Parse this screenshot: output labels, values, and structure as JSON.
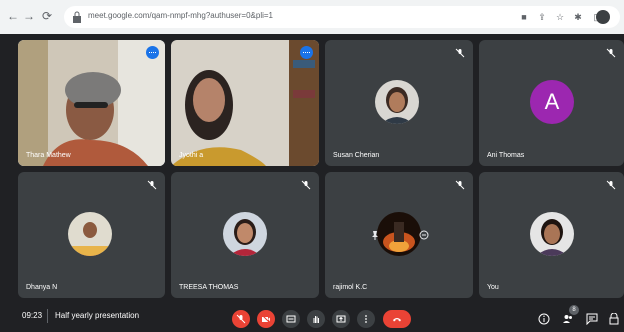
{
  "browser": {
    "url": "meet.google.com/qam-nmpf-mhg?authuser=0&pli=1"
  },
  "participants": [
    {
      "name": "Thara Mathew",
      "speaking": true
    },
    {
      "name": "Jyothi a",
      "speaking": false
    },
    {
      "name": "Susan Cherian",
      "speaking": false
    },
    {
      "name": "Ani Thomas",
      "avatar_letter": "A",
      "avatar_color": "#9c27b0"
    },
    {
      "name": "Dhanya N"
    },
    {
      "name": "TREESA THOMAS"
    },
    {
      "name": "rajimol K.C"
    },
    {
      "name": "You"
    }
  ],
  "bottom": {
    "time": "09:23",
    "meeting_title": "Half yearly presentation",
    "participant_count": "8"
  },
  "colors": {
    "background": "#202124",
    "tile": "#3c4043",
    "danger": "#ea4335",
    "accent": "#8ab4f8"
  }
}
